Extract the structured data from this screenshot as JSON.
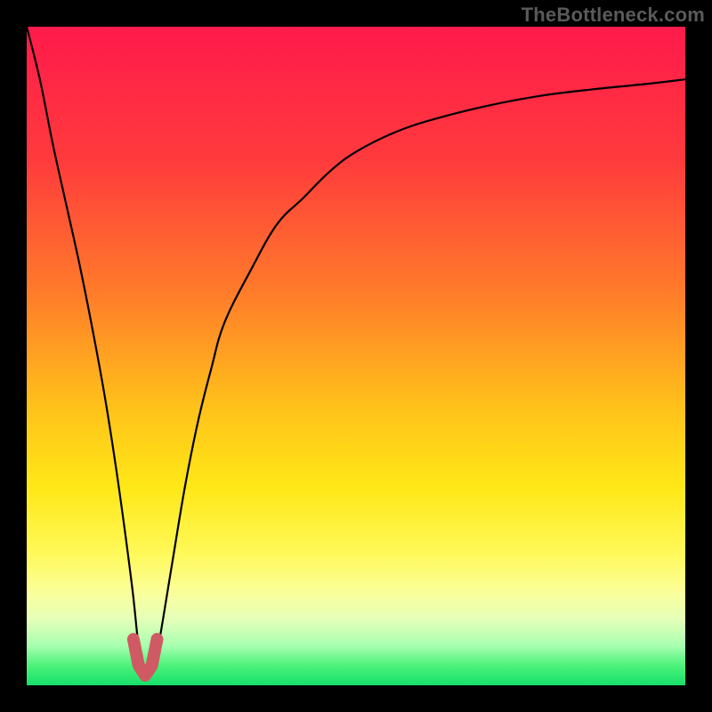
{
  "watermark": {
    "text": "TheBottleneck.com"
  },
  "colors": {
    "curve": "#000000",
    "marker": "#cf5a63",
    "frame": "#000000"
  },
  "chart_data": {
    "type": "line",
    "title": "",
    "xlabel": "",
    "ylabel": "",
    "xlim": [
      0,
      100
    ],
    "ylim": [
      0,
      100
    ],
    "grid": false,
    "legend": false,
    "annotations": [],
    "series": [
      {
        "name": "bottleneck-curve",
        "x": [
          0,
          2,
          4,
          6,
          8,
          10,
          12,
          14,
          16,
          17,
          18,
          19,
          20,
          22,
          24,
          26,
          28,
          30,
          34,
          38,
          42,
          46,
          50,
          56,
          62,
          70,
          78,
          86,
          94,
          100
        ],
        "values": [
          100,
          92,
          82,
          73,
          64,
          54,
          43,
          30,
          15,
          6,
          2,
          2,
          6,
          18,
          30,
          40,
          48,
          55,
          63,
          70,
          74,
          78,
          81,
          84,
          86,
          88,
          89.5,
          90.5,
          91.3,
          92
        ]
      }
    ],
    "marker": {
      "name": "minimum-region",
      "x": [
        16.2,
        17,
        18,
        19,
        19.8
      ],
      "values": [
        7,
        3,
        1.5,
        3,
        7
      ]
    }
  }
}
